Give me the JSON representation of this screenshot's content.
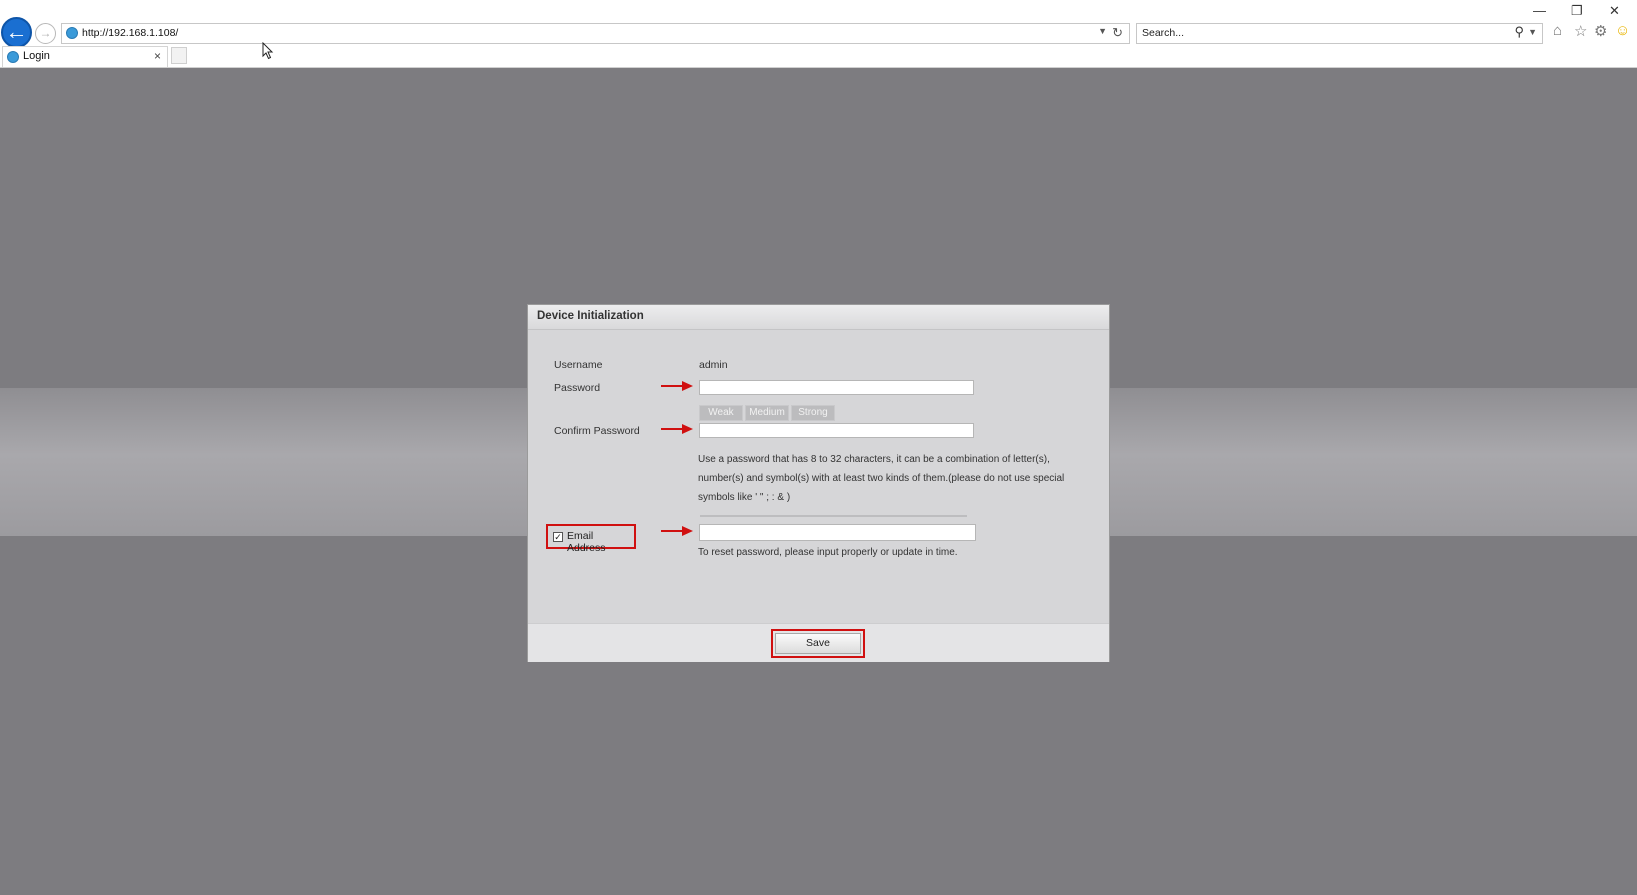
{
  "browser": {
    "url": "http://192.168.1.108/",
    "search_placeholder": "Search...",
    "tab_title": "Login",
    "tab_close": "×"
  },
  "dialog": {
    "title": "Device Initialization",
    "username_label": "Username",
    "username_value": "admin",
    "password_label": "Password",
    "strength_levels": [
      "Weak",
      "Medium",
      "Strong"
    ],
    "confirm_label": "Confirm Password",
    "hint_lines": [
      "Use a password that has 8 to 32 characters, it can be a combination of letter(s),",
      "number(s) and symbol(s) with at least two kinds of them.(please do not use special",
      "symbols like ' \" ; : & )"
    ],
    "email_label": "Email Address",
    "email_checked": true,
    "reset_hint": "To reset password, please input properly or update in time.",
    "save_label": "Save"
  },
  "colors": {
    "annotation_red": "#d01010",
    "page_background": "#7d7c80",
    "browser_accent": "#1a6fd1"
  }
}
